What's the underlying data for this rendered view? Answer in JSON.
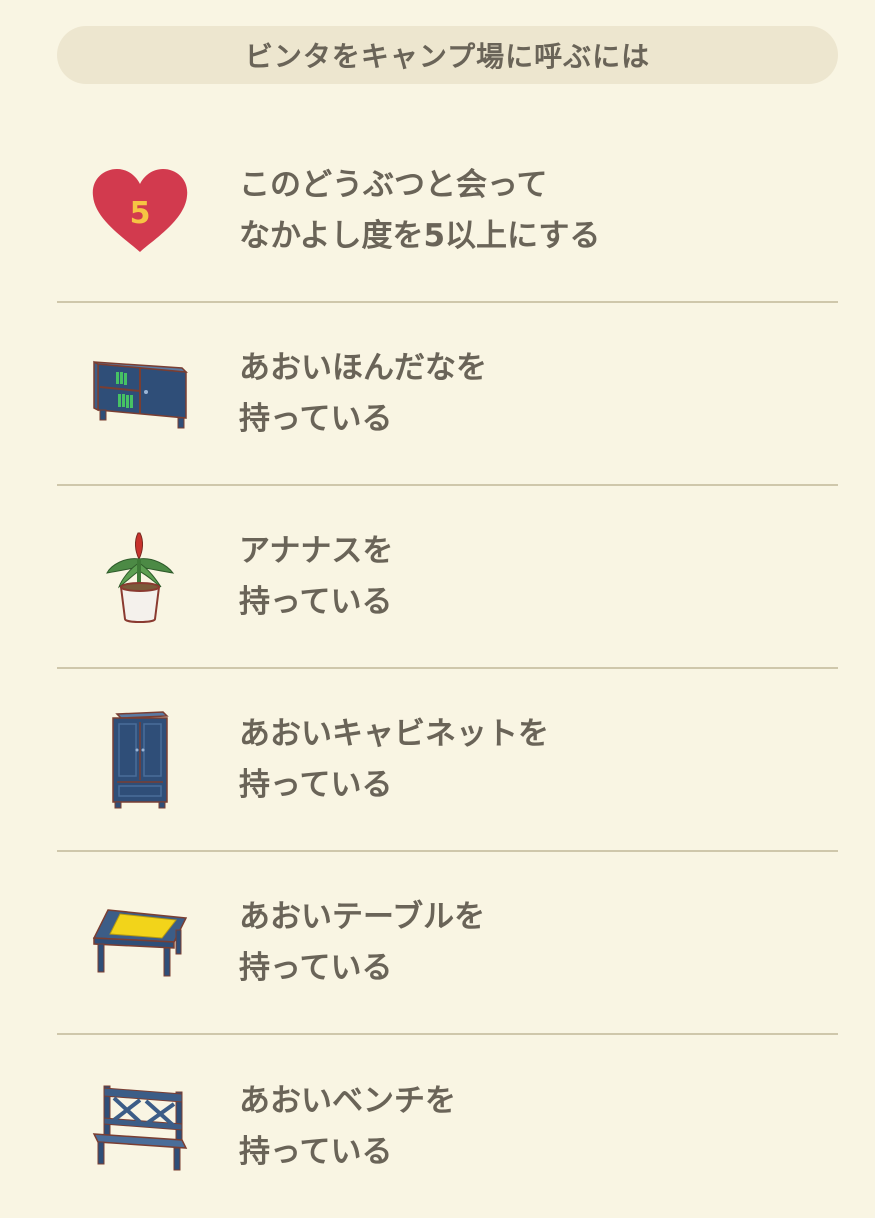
{
  "header": {
    "title": "ビンタをキャンプ場に呼ぶには"
  },
  "requirements": [
    {
      "icon": "heart-icon",
      "badge": "5",
      "line1": "このどうぶつと会って",
      "line2": "なかよし度を5以上にする"
    },
    {
      "icon": "blue-bookshelf-icon",
      "line1": "あおいほんだなを",
      "line2": "持っている"
    },
    {
      "icon": "pineapple-plant-icon",
      "line1": "アナナスを",
      "line2": "持っている"
    },
    {
      "icon": "blue-cabinet-icon",
      "line1": "あおいキャビネットを",
      "line2": "持っている"
    },
    {
      "icon": "blue-table-icon",
      "line1": "あおいテーブルを",
      "line2": "持っている"
    },
    {
      "icon": "blue-bench-icon",
      "line1": "あおいベンチを",
      "line2": "持っている"
    }
  ],
  "colors": {
    "background": "#f9f5e3",
    "header_bg": "#ede6cf",
    "text": "#6a6458",
    "divider": "#cfc7ab",
    "heart": "#d23a4e",
    "heart_number": "#f6c443",
    "furniture_blue": "#3c5d87"
  }
}
